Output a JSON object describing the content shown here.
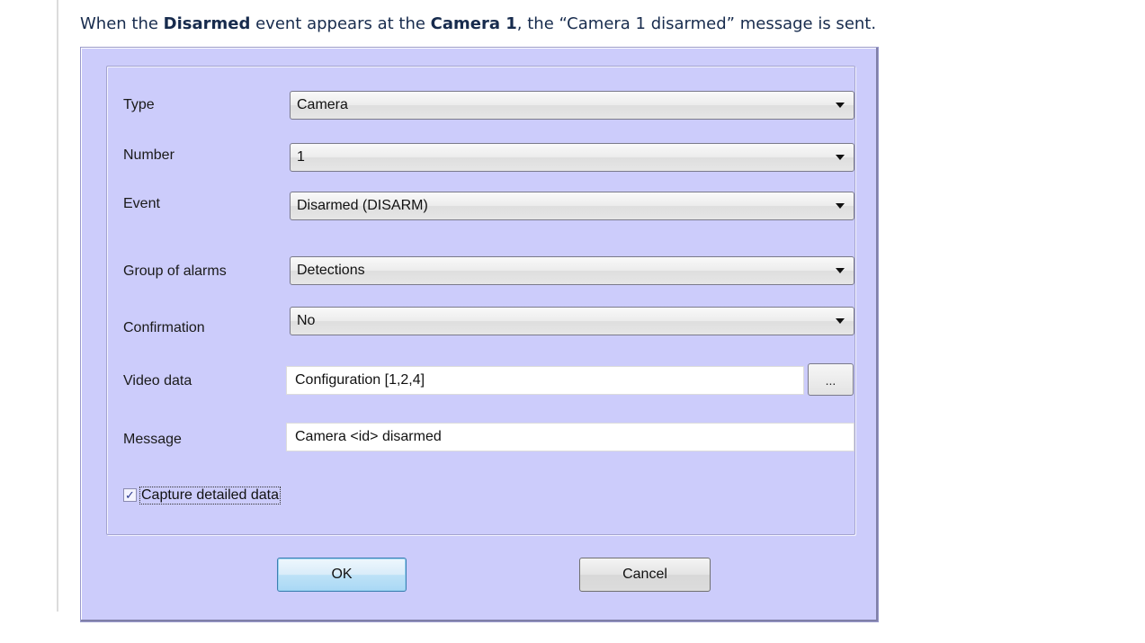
{
  "intro": {
    "prefix": "When the ",
    "event_name": "Disarmed",
    "middle": " event appears at the ",
    "camera_name": "Camera 1",
    "suffix": ", the “Camera 1 disarmed” message is sent."
  },
  "form": {
    "type": {
      "label": "Type",
      "value": "Camera"
    },
    "number": {
      "label": "Number",
      "value": "1"
    },
    "event": {
      "label": "Event",
      "value": "Disarmed (DISARM)"
    },
    "group_of_alarms": {
      "label": "Group of alarms",
      "value": "Detections"
    },
    "confirmation": {
      "label": "Confirmation",
      "value": "No"
    },
    "video_data": {
      "label": "Video data",
      "value": "Configuration [1,2,4]",
      "browse_label": "..."
    },
    "message": {
      "label": "Message",
      "value": "Camera <id> disarmed"
    },
    "capture_detailed": {
      "label": "Capture detailed data",
      "checked": true,
      "check_mark": "✓"
    }
  },
  "buttons": {
    "ok_label": "OK",
    "cancel_label": "Cancel"
  },
  "icons": {
    "dropdown": "chevron-down-icon",
    "check": "checkmark-icon"
  },
  "colors": {
    "dialog_bg": "#ccccfb",
    "default_button_border": "#3c7fb1"
  }
}
